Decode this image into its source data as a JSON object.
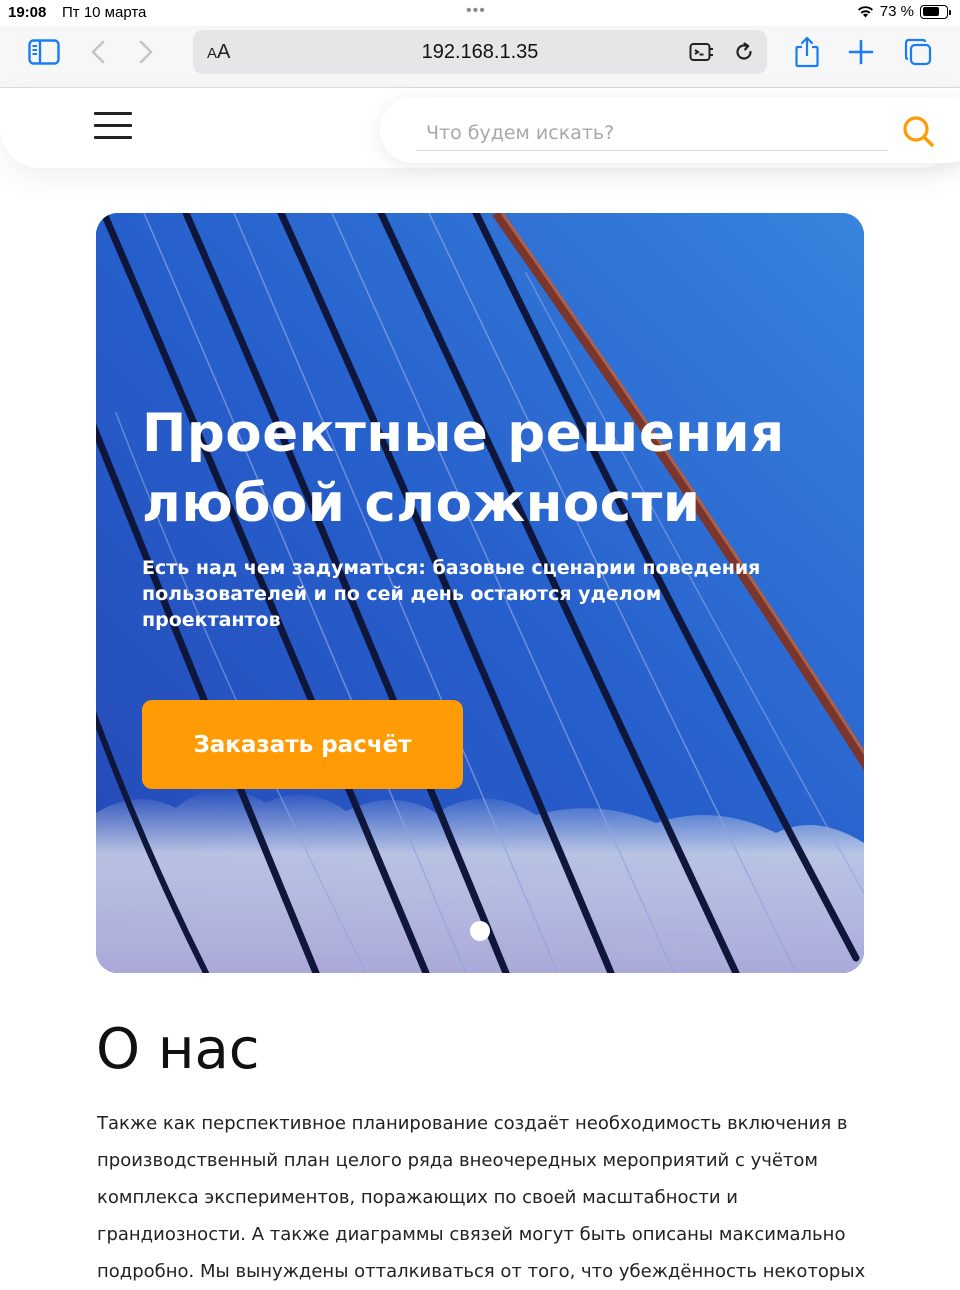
{
  "status_bar": {
    "time": "19:08",
    "date": "Пт 10 марта",
    "battery": "73 %",
    "battery_level": 0.73
  },
  "browser": {
    "text_size_label": "AA",
    "url": "192.168.1.35"
  },
  "header": {
    "search_placeholder": "Что будем искать?"
  },
  "hero": {
    "title_line1": "Проектные решения",
    "title_line2": "любой сложности",
    "subtitle": "Есть над чем задуматься: базовые сценарии поведения пользователей и по сей день остаются уделом проектантов",
    "cta_label": "Заказать расчёт"
  },
  "about": {
    "title": "О нас",
    "text": "Также как перспективное планирование создаёт необходимость включения в производственный план целого ряда внеочередных мероприятий с учётом комплекса экспериментов, поражающих по своей масштабности и грандиозности. А также диаграммы связей могут быть описаны максимально подробно. Мы вынуждены отталкиваться от того, что убеждённость некоторых"
  },
  "colors": {
    "accent": "#ff9b05",
    "browser_tint": "#1a7cf5",
    "sky": "#2d6fe0"
  }
}
